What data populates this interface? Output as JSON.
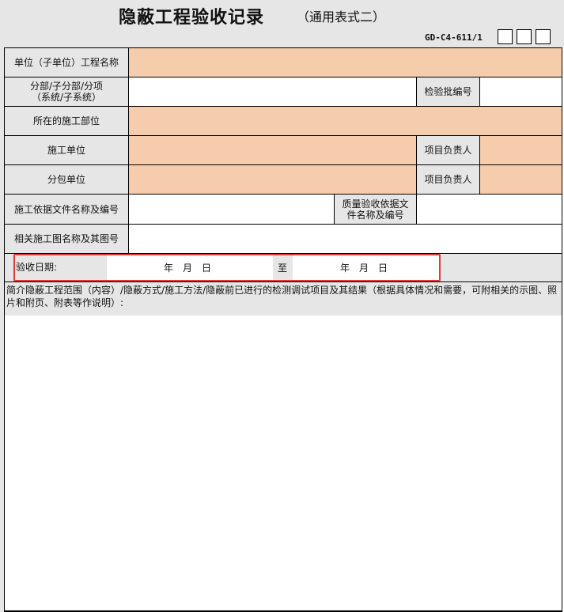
{
  "title": {
    "main": "隐蔽工程验收记录",
    "sub": "（通用表式二）"
  },
  "form_code": "GD-C4-611/1",
  "rows": {
    "project_name": "单位（子单位）工程名称",
    "subdivision_line1": "分部/子分部/分项",
    "subdivision_line2": "（系统/子系统）",
    "batch_no": "检验批编号",
    "location": "所在的施工部位",
    "contractor": "施工单位",
    "contractor_leader": "项目负责人",
    "subcontractor": "分包单位",
    "subcontractor_leader": "项目负责人",
    "basis_docs": "施工依据文件名称及编号",
    "quality_basis_line1": "质量验收依据文",
    "quality_basis_line2": "件名称及编号",
    "drawings": "相关施工图名称及其图号"
  },
  "date_row": {
    "label": "验收日期:",
    "start": "年　月　日",
    "to": "至",
    "end": "年　月　日"
  },
  "note": "简介隐蔽工程范围（内容）/隐蔽方式/施工方法/隐蔽前已进行的检测调试项目及其结果（根据具体情况和需要，可附相关的示图、照片和附页、附表等作说明）:",
  "colors": {
    "input_fill": "#f6cdac",
    "label_fill": "#e6e6e6",
    "highlight": "#e53935"
  }
}
